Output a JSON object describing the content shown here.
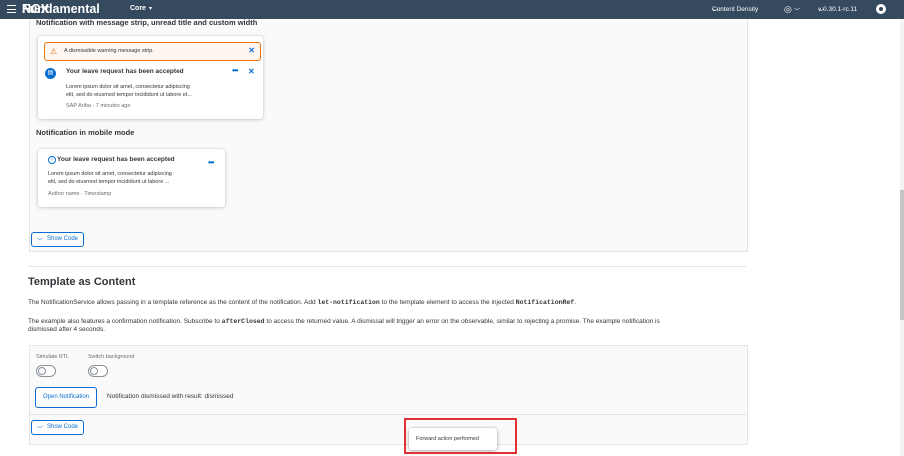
{
  "header": {
    "brand_prefix": "Fundamental ",
    "brand_suffix": "NGX",
    "product": "Core",
    "content_density": "Content Density",
    "version": "v 0.30.1-rc.11"
  },
  "section1": {
    "strip_heading": "Notification with message strip, unread title and custom width",
    "warning_text": "A dismissible warning message strip.",
    "notif1": {
      "title": "Your leave request has been accepted",
      "body_line1": "Lorem ipsum dolor sit amet, consectetur adipiscing",
      "body_line2": "elit, sed do eiusmod tempor incididunt ut labore et...",
      "source": "SAP Ariba",
      "time": "7 minutes ago"
    },
    "mobile_heading": "Notification in mobile mode",
    "notif2": {
      "title": "Your leave request has been accepted",
      "body_line1": "Lorem ipsum dolor sit amet, consectetur adipiscing",
      "body_line2": "elit, sed do eiusmod tempor incididunt ut labore ...",
      "author": "Author name",
      "timestamp": "Timestamp"
    },
    "show_code": "Show Code"
  },
  "section2": {
    "title": "Template as Content",
    "desc1_a": "The NotificationService allows passing in a template reference as the content of the notification. Add ",
    "desc1_code1": "let-notification",
    "desc1_b": " to the template element to access the injected ",
    "desc1_code2": "NotificationRef",
    "desc1_c": ".",
    "desc2_a": "The example also features a confirmation notification. Subscribe to ",
    "desc2_code": "afterClosed",
    "desc2_b": " to access the returned value. A dismissal will trigger an error on the observable, similar to rejecting a promise. The example notification is",
    "desc2_line2": "dismissed after 4 seconds.",
    "simulate_rtl": "Simulate RTL",
    "switch_background": "Switch background",
    "open_button": "Open Notification",
    "result": "Notification dismissed with result: dismissed",
    "show_code": "Show Code"
  },
  "toast": {
    "text": "Forward action performed"
  },
  "colors": {
    "shell_bg": "#354a5f",
    "accent": "#0a6ed1",
    "warning": "#e9730c",
    "highlight": "#e03131"
  }
}
